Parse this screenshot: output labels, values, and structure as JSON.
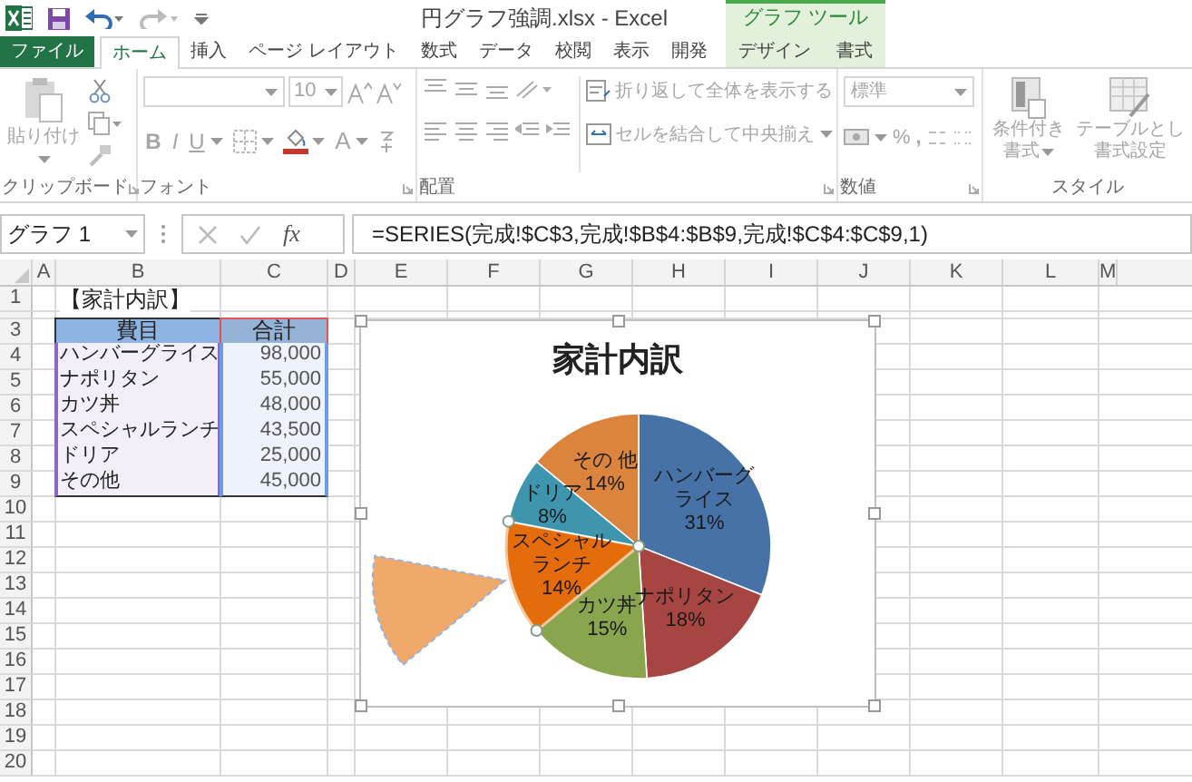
{
  "title_bar": {
    "title": "円グラフ強調.xlsx - Excel",
    "context_group": "グラフ ツール"
  },
  "tabs": [
    {
      "label": "ファイル",
      "kind": "file",
      "selected": false
    },
    {
      "label": "ホーム",
      "kind": "normal",
      "selected": true
    },
    {
      "label": "挿入",
      "kind": "normal",
      "selected": false
    },
    {
      "label": "ページ レイアウト",
      "kind": "normal",
      "selected": false
    },
    {
      "label": "数式",
      "kind": "normal",
      "selected": false
    },
    {
      "label": "データ",
      "kind": "normal",
      "selected": false
    },
    {
      "label": "校閲",
      "kind": "normal",
      "selected": false
    },
    {
      "label": "表示",
      "kind": "normal",
      "selected": false
    },
    {
      "label": "開発",
      "kind": "normal",
      "selected": false
    },
    {
      "label": "デザイン",
      "kind": "context",
      "selected": false
    },
    {
      "label": "書式",
      "kind": "context",
      "selected": false
    }
  ],
  "ribbon": {
    "disabled": true,
    "clipboard": {
      "paste": "貼り付け",
      "label": "クリップボード"
    },
    "font": {
      "size": "10",
      "bold": "B",
      "italic": "I",
      "underline": "U",
      "font_color": "A",
      "label": "フォント"
    },
    "alignment": {
      "wrap_text": "折り返して全体を表示する",
      "merge_center": "セルを結合して中央揃え",
      "label": "配置"
    },
    "number": {
      "format": "標準",
      "percent": "%",
      "comma": ",",
      "label": "数値"
    },
    "styles": {
      "conditional_lines": [
        "条件付き",
        "書式"
      ],
      "table_lines": [
        "テーブルとし",
        "書式設定"
      ],
      "label": "スタイル"
    }
  },
  "formula_bar": {
    "name_box": "グラフ 1",
    "function_button": "fx",
    "formula": "=SERIES(完成!$C$3,完成!$B$4:$B$9,完成!$C$4:$C$9,1)"
  },
  "sheet": {
    "columns": [
      "A",
      "B",
      "C",
      "D",
      "E",
      "F",
      "G",
      "H",
      "I",
      "J",
      "K",
      "L",
      "M"
    ],
    "rows": [
      "1",
      "3",
      "4",
      "5",
      "6",
      "7",
      "8",
      "9",
      "10",
      "11",
      "12",
      "13",
      "14",
      "15",
      "16",
      "17",
      "18",
      "19",
      "20"
    ],
    "title": "【家計内訳】",
    "headers": [
      "費目",
      "合計"
    ],
    "table_rows": [
      [
        "ハンバーグライス",
        "98,000"
      ],
      [
        "ナポリタン",
        "55,000"
      ],
      [
        "カツ丼",
        "48,000"
      ],
      [
        "スペシャルランチ",
        "43,500"
      ],
      [
        "ドリア",
        "25,000"
      ],
      [
        "その他",
        "45,000"
      ]
    ]
  },
  "chart": {
    "chart_data": {
      "type": "pie",
      "title": "家計内訳",
      "categories": [
        "ハンバーグライス",
        "ナポリタン",
        "カツ丼",
        "スペシャルランチ",
        "ドリア",
        "その 他"
      ],
      "values": [
        31,
        18,
        15,
        14,
        8,
        14
      ],
      "value_labels": [
        "31%",
        "18%",
        "15%",
        "14%",
        "8%",
        "14%"
      ]
    },
    "slices": [
      {
        "color": "#4672a8",
        "selected": false
      },
      {
        "color": "#a64542",
        "selected": false
      },
      {
        "color": "#89a54e",
        "selected": false
      },
      {
        "color": "#e46c0a",
        "selected": true
      },
      {
        "color": "#3d96ae",
        "selected": false
      },
      {
        "color": "#db843d",
        "selected": false
      }
    ]
  }
}
